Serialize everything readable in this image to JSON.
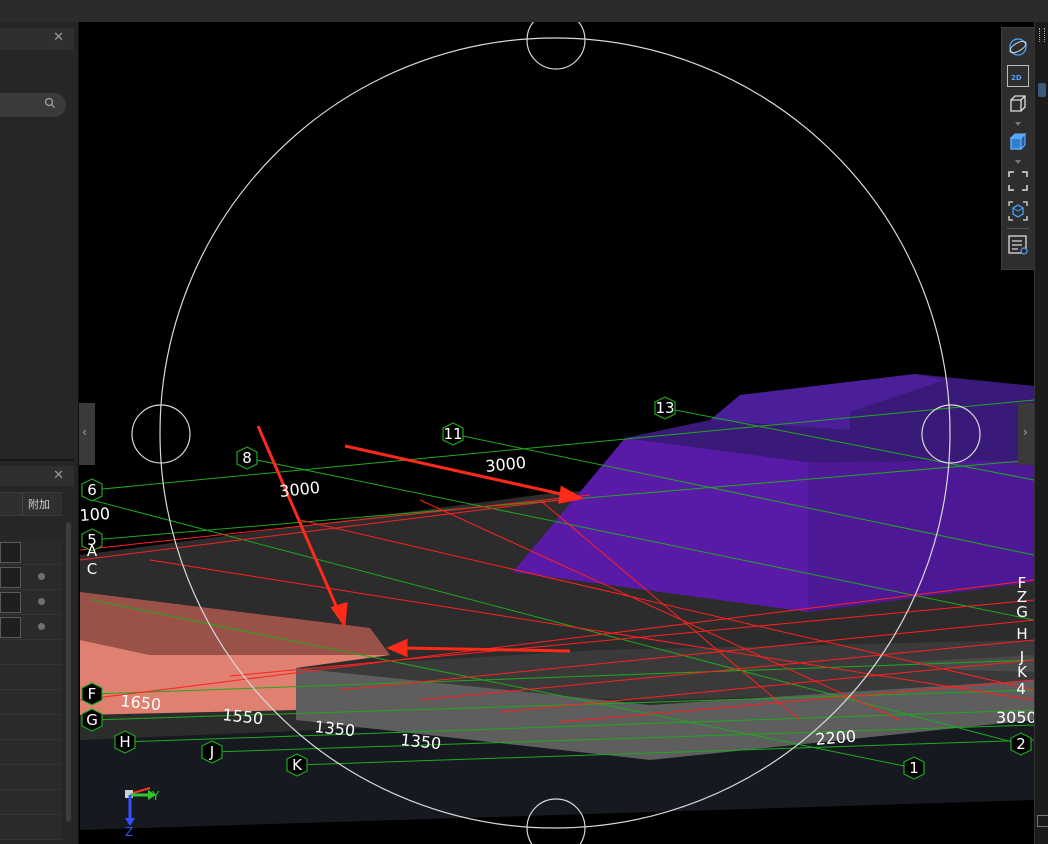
{
  "left_panel": {
    "close_glyph": "✕",
    "lower_close_glyph": "✕",
    "column_header": "附加",
    "search_icon": "search-icon"
  },
  "toolbar": {
    "view_2d_label": "2D",
    "buttons": [
      "orbit-icon",
      "view-2d-icon",
      "view-3d-icon",
      "perspective-cube-icon",
      "fit-view-icon",
      "isolate-icon",
      "properties-icon"
    ]
  },
  "viewport": {
    "grid_numbers": {
      "g1": "1",
      "g2": "2",
      "g4": "4",
      "g5": "5",
      "g6": "6",
      "g8": "8",
      "g11": "11",
      "g13": "13"
    },
    "grid_letters": {
      "gF": "F",
      "gG": "G",
      "gH": "H",
      "gJ": "J",
      "gK": "K",
      "rF": "F",
      "rZ": "Z",
      "rG": "G",
      "rH": "H",
      "rJ": "J",
      "rK": "K",
      "lA": "A",
      "lC": "C"
    },
    "dimensions": {
      "d3000a": "3000",
      "d3000b": "3000",
      "d100": "100",
      "d1650": "1650",
      "d1550": "1550",
      "d1350a": "1350",
      "d1350b": "1350",
      "d2200": "2200",
      "d3050": "3050"
    },
    "axis": {
      "y": "Y",
      "z": "Z"
    },
    "colors": {
      "purple_top": "#3a1a78",
      "purple_front": "#5a1aa8",
      "salmon": "#e08070",
      "floor": "#2c2c2c",
      "grey_slab": "#5e5e5e",
      "red_line": "#ff2020",
      "green_line": "#1fa81f"
    }
  }
}
